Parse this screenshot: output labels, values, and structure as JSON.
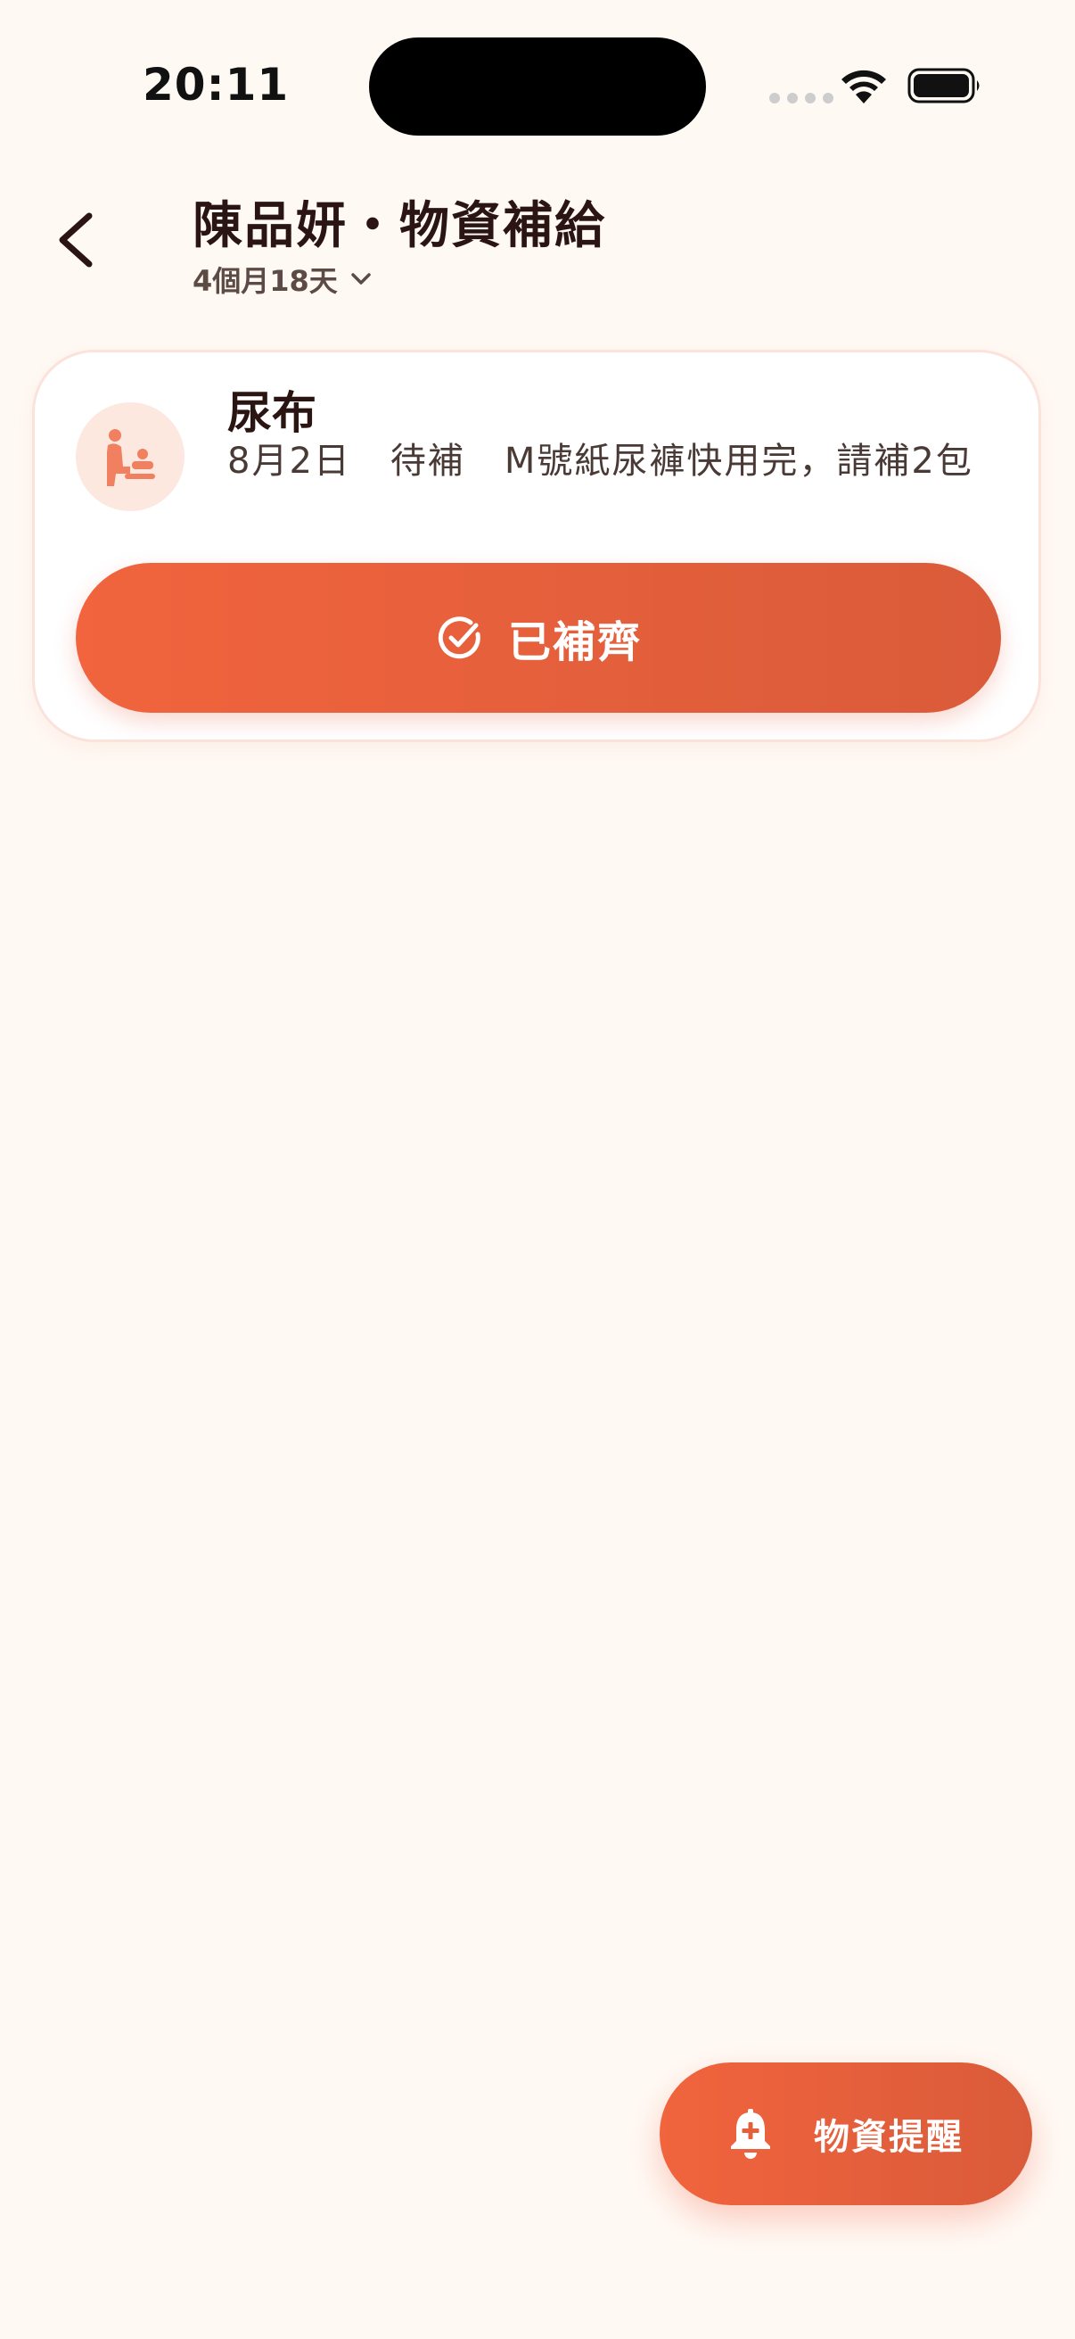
{
  "status_bar": {
    "time": "20:11"
  },
  "header": {
    "title": "陳品妍・物資補給",
    "age": "4個月18天"
  },
  "supply_item": {
    "icon": "baby-changing-icon",
    "name": "尿布",
    "date": "8月2日",
    "status": "待補",
    "note": "M號紙尿褲快用完，請補2包",
    "action_label": "已補齊"
  },
  "fab": {
    "icon": "bell-plus-icon",
    "label": "物資提醒"
  },
  "colors": {
    "background": "#FFF9F4",
    "accent": "#F1643D",
    "accent_dark": "#DA5B3A",
    "icon_bg": "#FDE8E0",
    "icon_fg": "#F08060"
  }
}
